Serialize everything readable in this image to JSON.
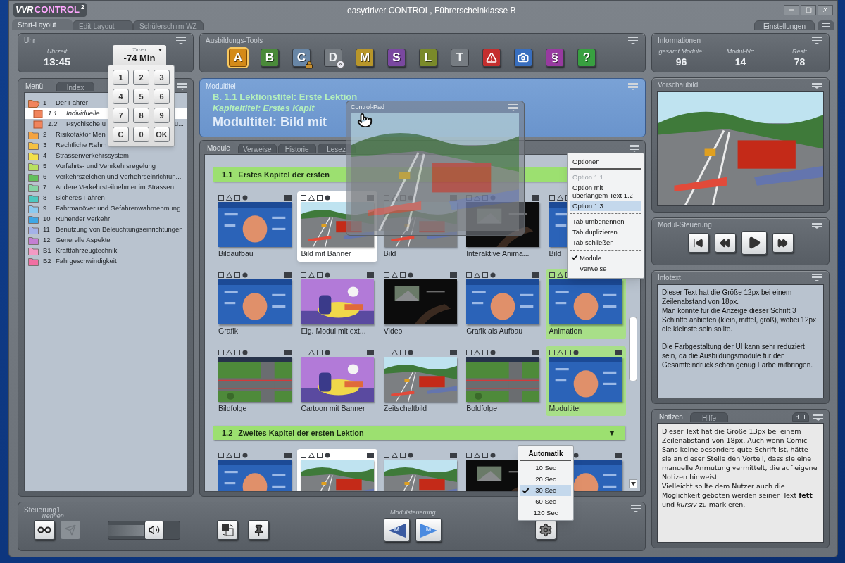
{
  "app": {
    "logo_prefix": "VVR",
    "logo_brand": "CONTROL",
    "logo_sup": "2",
    "title": "easydriver CONTROL, Führerscheinklasse B"
  },
  "layout_tabs": [
    {
      "label": "Start-Layout",
      "selected": true
    },
    {
      "label": "Edit-Layout",
      "selected": false
    },
    {
      "label": "Schülerschirm WZ",
      "selected": false
    }
  ],
  "settings_tab": {
    "label": "Einstellungen"
  },
  "clock": {
    "title": "Uhr",
    "time_label": "Uhrzeit",
    "time": "13:45"
  },
  "timer": {
    "label": "Timer",
    "value": "-74 Min",
    "keys": [
      "1",
      "2",
      "3",
      "4",
      "5",
      "6",
      "7",
      "8",
      "9",
      "C",
      "0",
      "OK"
    ]
  },
  "menu_panel": {
    "tabs": [
      {
        "label": "Menü",
        "selected": true
      },
      {
        "label": "Index",
        "selected": false
      }
    ],
    "items": [
      {
        "number": "1",
        "label": "Der Fahrer",
        "color": "#f0845c",
        "expanded": true,
        "selected": false,
        "children": [
          {
            "number": "1.1",
            "label": "Individuelle",
            "color": "#f0845c",
            "selected": true
          },
          {
            "number": "1.2",
            "label": "Psychische u",
            "label_end": "u...",
            "color": "#f0845c",
            "selected": false
          }
        ]
      },
      {
        "number": "2",
        "label": "Risikofaktor Men",
        "color": "#f4a340",
        "expanded": false,
        "selected": false
      },
      {
        "number": "3",
        "label": "Rechtliche Rahm",
        "color": "#f5c040",
        "expanded": false,
        "selected": false
      },
      {
        "number": "4",
        "label": "Strassenverkehrssystem",
        "color": "#f2e04a",
        "expanded": false,
        "selected": false
      },
      {
        "number": "5",
        "label": "Vorfahrts- und Vehrkehrsregelung",
        "color": "#b8e060",
        "expanded": false,
        "selected": false
      },
      {
        "number": "6",
        "label": "Verkehrszeichen und Verhehrseinrichtun...",
        "color": "#62c05a",
        "expanded": false,
        "selected": false
      },
      {
        "number": "7",
        "label": "Andere Verkehrsteilnehmer im Strassen...",
        "color": "#86d4a4",
        "expanded": false,
        "selected": false
      },
      {
        "number": "8",
        "label": "Sicheres Fahren",
        "color": "#4cc8c0",
        "expanded": false,
        "selected": false
      },
      {
        "number": "9",
        "label": "Fahrmanöver und Gefahrenwahrnehmung",
        "color": "#8ccaf0",
        "expanded": false,
        "selected": false
      },
      {
        "number": "10",
        "label": "Ruhender Verkehr",
        "color": "#3ea6e6",
        "expanded": false,
        "selected": false
      },
      {
        "number": "11",
        "label": "Benutzung von Beleuchtungseinrichtungen",
        "color": "#a4b2e8",
        "expanded": false,
        "selected": false
      },
      {
        "number": "12",
        "label": "Generelle Aspekte",
        "color": "#c47ed2",
        "expanded": false,
        "selected": false
      },
      {
        "number": "B1",
        "label": "Kraftfahrzeugtechnik",
        "color": "#f29ac4",
        "expanded": false,
        "selected": false
      },
      {
        "number": "B2",
        "label": "Fahrgeschwindigkeit",
        "color": "#f06ea2",
        "expanded": false,
        "selected": false
      }
    ]
  },
  "tools": {
    "title": "Ausbildungs-Tools",
    "items": [
      {
        "kind": "letter",
        "label": "A",
        "color": "#d48a18",
        "selected": true,
        "disabled": false
      },
      {
        "kind": "letter",
        "label": "B",
        "color": "#4a8a3a",
        "selected": false,
        "disabled": false
      },
      {
        "kind": "letter",
        "label": "C",
        "color": "#6886a6",
        "selected": false,
        "disabled": false,
        "locked": true
      },
      {
        "kind": "letter",
        "label": "D",
        "color": "#767c82",
        "selected": false,
        "disabled": true,
        "disc": true
      },
      {
        "kind": "letter",
        "label": "M",
        "color": "#b8962a",
        "selected": false,
        "disabled": false
      },
      {
        "kind": "letter",
        "label": "S",
        "color": "#7a48a0",
        "selected": false,
        "disabled": false
      },
      {
        "kind": "letter",
        "label": "L",
        "color": "#7a8a2a",
        "selected": false,
        "disabled": false
      },
      {
        "kind": "letter",
        "label": "T",
        "color": "#767c82",
        "selected": false,
        "disabled": true
      },
      {
        "kind": "warning",
        "color": "#c42e2e",
        "selected": false,
        "disabled": false
      },
      {
        "kind": "camera",
        "color": "#386ebe",
        "selected": false,
        "disabled": false
      },
      {
        "kind": "letter",
        "label": "§",
        "color": "#983aa0",
        "selected": false,
        "disabled": false
      },
      {
        "kind": "letter",
        "label": "?",
        "color": "#38a040",
        "selected": false,
        "disabled": false
      }
    ]
  },
  "module_title": {
    "title": "Modultitel",
    "lesson": "B. 1.1 Lektionstitel: Erste Lektion",
    "chapter": "Kapiteltitel: Erstes Kapit",
    "module": "Modultitel: Bild mit"
  },
  "modules": {
    "tabs": [
      {
        "label": "Module",
        "selected": true
      },
      {
        "label": "Verweise",
        "selected": false
      },
      {
        "label": "Historie",
        "selected": false
      },
      {
        "label": "Lesez",
        "selected": false
      }
    ],
    "sections": [
      {
        "number": "1.1",
        "title": "Erstes Kapitel der ersten",
        "tiles": [
          {
            "title": "Bildaufbau",
            "selected": false,
            "marked": false
          },
          {
            "title": "Bild mit Banner",
            "selected": true,
            "marked": false
          },
          {
            "title": "Bild",
            "selected": false,
            "marked": false
          },
          {
            "title": "Interaktive Anima...",
            "selected": false,
            "marked": false
          },
          {
            "title": "Bild",
            "selected": false,
            "marked": false
          },
          {
            "title": "Grafik",
            "selected": false,
            "marked": false
          },
          {
            "title": "Eig. Modul mit ext...",
            "selected": false,
            "marked": false
          },
          {
            "title": "Video",
            "selected": false,
            "marked": false
          },
          {
            "title": "Grafik als Aufbau",
            "selected": false,
            "marked": false
          },
          {
            "title": "Animation",
            "selected": false,
            "marked": true
          },
          {
            "title": "Bildfolge",
            "selected": false,
            "marked": false
          },
          {
            "title": "Cartoon mit Banner",
            "selected": false,
            "marked": false
          },
          {
            "title": "Zeitschaltbild",
            "selected": false,
            "marked": false
          },
          {
            "title": "Boldfolge",
            "selected": false,
            "marked": false
          },
          {
            "title": "Modultitel",
            "selected": false,
            "marked": true
          }
        ]
      },
      {
        "number": "1.2",
        "title": "Zweites Kapitel der ersten Lektion",
        "toggle": "▼",
        "tiles": [
          {
            "selected": false,
            "marked": false
          },
          {
            "selected": true,
            "marked": false
          },
          {
            "selected": false,
            "marked": false
          },
          {
            "selected": false,
            "marked": false
          },
          {
            "selected": false,
            "marked": false
          }
        ]
      }
    ]
  },
  "control_pad": {
    "title": "Control-Pad"
  },
  "options_menu": {
    "title": "Optionen",
    "groups": [
      {
        "items": [
          {
            "label": "Option 1.1",
            "disabled": true,
            "selected": false
          },
          {
            "label": "Option mit überlangem Text 1.2",
            "disabled": false,
            "selected": false
          },
          {
            "label": "Option 1.3",
            "disabled": false,
            "selected": true
          }
        ]
      },
      {
        "items": [
          {
            "label": "Tab umbenennen",
            "disabled": false,
            "selected": false
          },
          {
            "label": "Tab duplizieren",
            "disabled": false,
            "selected": false
          },
          {
            "label": "Tab schließen",
            "disabled": false,
            "selected": false
          }
        ]
      },
      {
        "items": [
          {
            "label": "Module",
            "disabled": false,
            "selected": false,
            "checked": true
          },
          {
            "label": "Verweise",
            "disabled": false,
            "selected": false,
            "checked": false
          }
        ]
      }
    ]
  },
  "info": {
    "title": "Informationen",
    "stats": [
      {
        "label": "gesamt Module:",
        "value": "96"
      },
      {
        "label": "Modul-Nr:",
        "value": "14"
      },
      {
        "label": "Rest:",
        "value": "78"
      }
    ]
  },
  "preview": {
    "title": "Vorschaubild"
  },
  "module_control": {
    "title": "Modul-Steuerung"
  },
  "infotext": {
    "title": "Infotext",
    "paragraphs": [
      {
        "lines": [
          "Dieser Text hat die Größe 12px bei einem Zeilenabstand von 18px.",
          "Man könnte für die Anzeige dieser Schrift 3 Schintte anbieten (klein, mittel, groß), wobei 12px die kleinste sein sollte."
        ]
      },
      {
        "lines": [
          "Die Farbgestaltung der UI kann sehr reduziert sein, da die Ausbildungsmodule für den Gesamteindruck schon genug Farbe mitbringen."
        ]
      }
    ]
  },
  "notes": {
    "tabs": [
      {
        "label": "Notizen",
        "selected": true
      },
      {
        "label": "Hilfe",
        "selected": false
      }
    ],
    "lines": [
      "Dieser Text hat die Größe 13px bei einem Zeilenabstand von 18px. Auch wenn Comic Sans keine besonders gute Schrift ist, hätte sie an dieser Stelle den Vorteil, dass sie eine manuelle Anmutung vermittelt, die auf eigene Notizen hinweist.",
      "Vielleicht sollte dem Nutzer auch die Möglichkeit geboten werden seinen Text **fett** und *kursiv* zu markieren."
    ]
  },
  "controls": {
    "title": "Steuerung1",
    "link_label": "Trennen",
    "send_disabled": true,
    "volume": {
      "level": 0.6
    },
    "nav_label": "Modulsteuerung",
    "nav": [
      {
        "kind": "prev",
        "label": "M"
      },
      {
        "kind": "next",
        "label": "M"
      }
    ]
  },
  "automatik": {
    "title": "Automatik",
    "items": [
      {
        "label": "10 Sec",
        "selected": false
      },
      {
        "label": "20 Sec",
        "selected": false
      },
      {
        "label": "30 Sec",
        "selected": true
      },
      {
        "label": "60 Sec",
        "selected": false
      },
      {
        "label": "120 Sec",
        "selected": false
      }
    ]
  }
}
